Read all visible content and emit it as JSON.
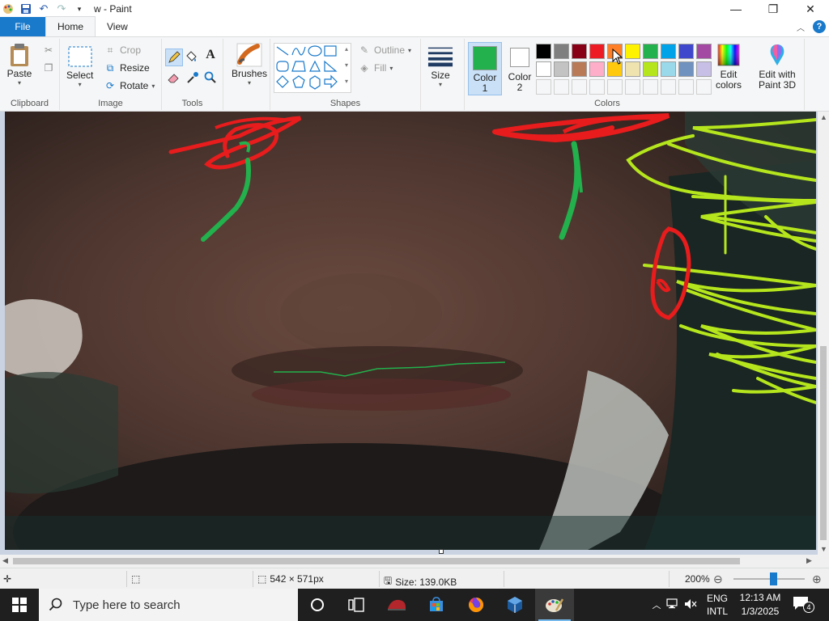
{
  "window": {
    "title": "w - Paint",
    "controls": [
      "minimize-icon",
      "restore-icon",
      "close-icon"
    ]
  },
  "tabs": [
    {
      "label": "File",
      "style": "file"
    },
    {
      "label": "Home",
      "active": true
    },
    {
      "label": "View"
    }
  ],
  "ribbon": {
    "clipboard": {
      "label": "Clipboard",
      "paste": "Paste"
    },
    "image": {
      "label": "Image",
      "select": "Select",
      "crop": "Crop",
      "resize": "Resize",
      "rotate": "Rotate"
    },
    "tools": {
      "label": "Tools"
    },
    "brushes": {
      "label": "Brushes"
    },
    "shapes": {
      "label": "Shapes",
      "outline": "Outline",
      "fill": "Fill"
    },
    "size": {
      "label": "Size"
    },
    "colors": {
      "label": "Colors",
      "color1_label": "Color 1",
      "color2_label": "Color 2",
      "color1_value": "#22b14c",
      "color2_value": "#ffffff",
      "edit_colors": "Edit colors",
      "edit_paint3d": "Edit with Paint 3D",
      "palette_row1": [
        "#000000",
        "#7f7f7f",
        "#880015",
        "#ed1c24",
        "#ff7f27",
        "#fff200",
        "#22b14c",
        "#00a2e8",
        "#3f48cc",
        "#a349a4"
      ],
      "palette_row2": [
        "#ffffff",
        "#c3c3c3",
        "#b97a57",
        "#ffaec9",
        "#ffc90e",
        "#efe4b0",
        "#b5e61d",
        "#99d9ea",
        "#7092be",
        "#c8bfe7"
      ]
    }
  },
  "status": {
    "dimensions": "542 × 571px",
    "size": "Size: 139.0KB",
    "zoom": "200%"
  },
  "taskbar": {
    "search_placeholder": "Type here to search",
    "language_top": "ENG",
    "language_bottom": "INTL",
    "time": "12:13 AM",
    "date": "1/3/2025",
    "notifications": "4"
  }
}
